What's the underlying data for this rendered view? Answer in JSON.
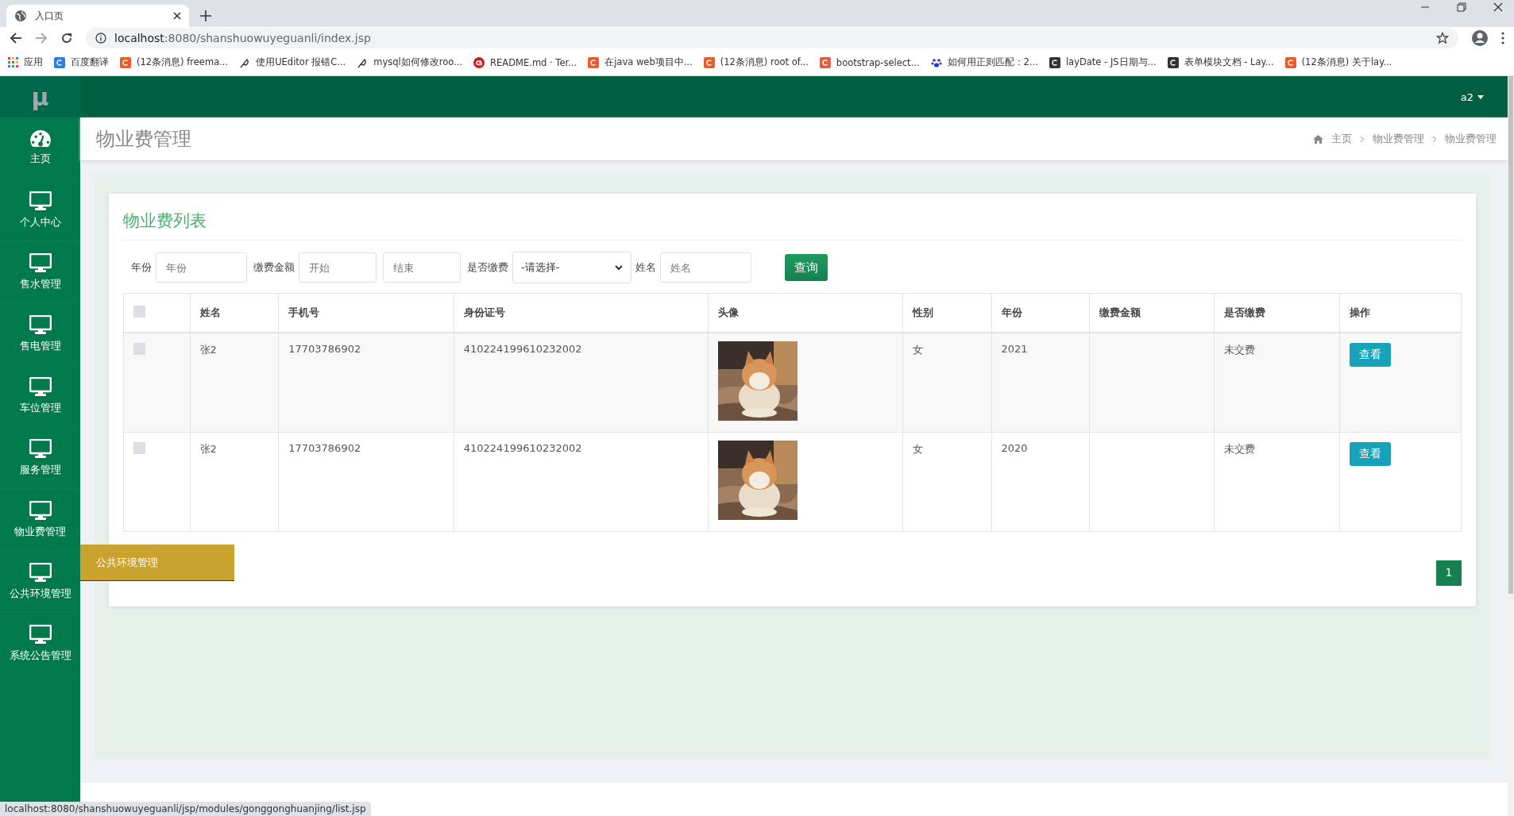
{
  "browser": {
    "tab_title": "入口页",
    "url_host": "localhost",
    "url_rest": ":8080/shanshuowuyeguanli/index.jsp",
    "bookmarks": [
      {
        "label": "应用",
        "kind": "apps"
      },
      {
        "label": "百度翻译",
        "kind": "translate"
      },
      {
        "label": "(12条消息) freema...",
        "kind": "csdn"
      },
      {
        "label": "使用UEditor 报错C...",
        "kind": "feather"
      },
      {
        "label": "mysql如何修改roo...",
        "kind": "feather"
      },
      {
        "label": "README.md · Ter...",
        "kind": "gitee"
      },
      {
        "label": "在java web项目中...",
        "kind": "csdn"
      },
      {
        "label": "(12条消息) root of...",
        "kind": "csdn"
      },
      {
        "label": "bootstrap-select...",
        "kind": "jian"
      },
      {
        "label": "如何用正则匹配：2...",
        "kind": "paw"
      },
      {
        "label": "layDate - JS日期与...",
        "kind": "lay"
      },
      {
        "label": "表单模块文档 - Lay...",
        "kind": "lay"
      },
      {
        "label": "(12条消息) 关于lay...",
        "kind": "csdn"
      }
    ]
  },
  "header": {
    "logo": "μ",
    "user": "a2"
  },
  "sidebar": {
    "items": [
      {
        "label": "主页",
        "kind": "dashboard"
      },
      {
        "label": "个人中心",
        "kind": "monitor"
      },
      {
        "label": "售水管理",
        "kind": "monitor"
      },
      {
        "label": "售电管理",
        "kind": "monitor"
      },
      {
        "label": "车位管理",
        "kind": "monitor"
      },
      {
        "label": "服务管理",
        "kind": "monitor"
      },
      {
        "label": "物业费管理",
        "kind": "monitor"
      },
      {
        "label": "公共环境管理",
        "kind": "monitor"
      },
      {
        "label": "系统公告管理",
        "kind": "monitor"
      }
    ],
    "tooltip": "公共环境管理"
  },
  "page": {
    "title": "物业费管理",
    "breadcrumb": [
      "主页",
      "物业费管理",
      "物业费管理"
    ]
  },
  "card": {
    "title": "物业费列表",
    "filters": [
      {
        "label": "年份",
        "fields": [
          {
            "placeholder": "年份",
            "kind": "text"
          }
        ]
      },
      {
        "label": "缴费金额",
        "fields": [
          {
            "placeholder": "开始",
            "kind": "text"
          },
          {
            "placeholder": "结束",
            "kind": "text"
          }
        ]
      },
      {
        "label": "是否缴费",
        "fields": [
          {
            "value": "-请选择-",
            "kind": "select"
          }
        ]
      },
      {
        "label": "姓名",
        "fields": [
          {
            "placeholder": "姓名",
            "kind": "text"
          }
        ]
      }
    ],
    "search_button": "查询",
    "table": {
      "select_all_checked": false,
      "columns": [
        "姓名",
        "手机号",
        "身份证号",
        "头像",
        "性别",
        "年份",
        "缴费金额",
        "是否缴费",
        "操作"
      ],
      "rows": [
        {
          "checked": false,
          "name": "张2",
          "phone": "17703786902",
          "id_number": "410224199610232002",
          "gender": "女",
          "year": "2021",
          "paid_status": "未交费",
          "action": "查看"
        },
        {
          "checked": false,
          "name": "张2",
          "phone": "17703786902",
          "id_number": "410224199610232002",
          "gender": "女",
          "year": "2020",
          "paid_status": "未交费",
          "action": "查看"
        }
      ]
    },
    "pagination": [
      {
        "label": "1",
        "selected": true
      }
    ]
  },
  "status_bar": "localhost:8080/shanshuowuyeguanli/jsp/modules/gonggonghuanjing/list.jsp"
}
